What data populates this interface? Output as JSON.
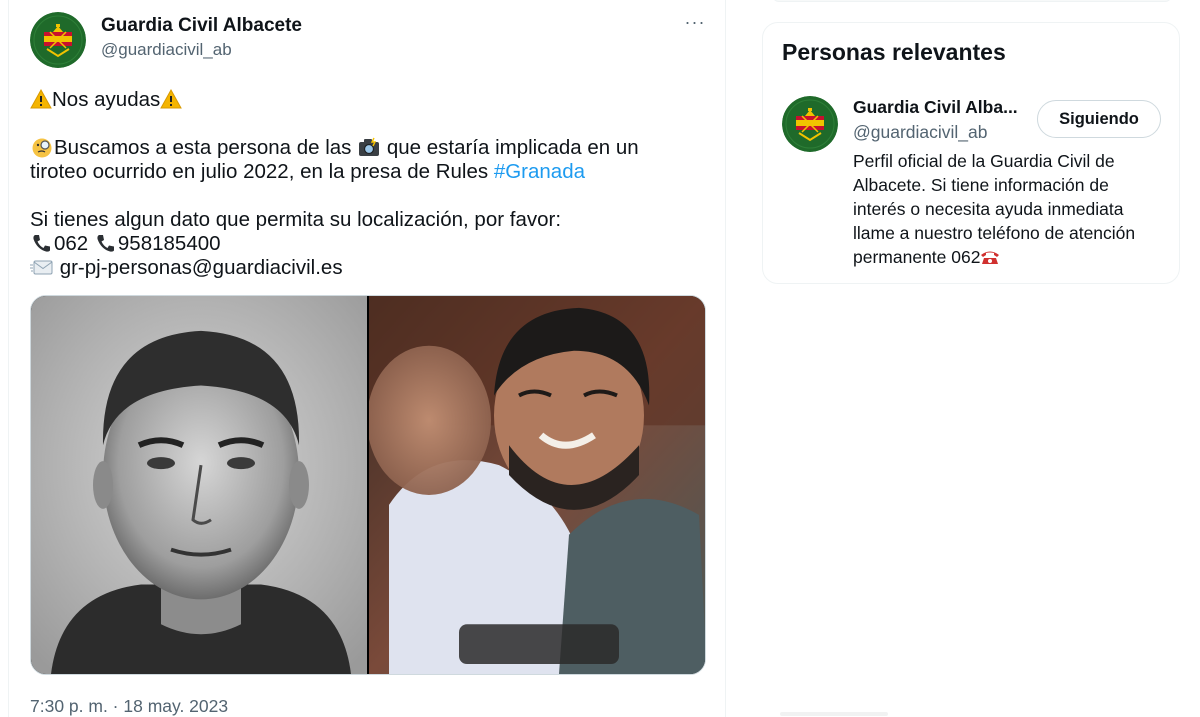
{
  "tweet": {
    "author_name": "Guardia Civil Albacete",
    "author_handle": "@guardiacivil_ab",
    "more_icon": "more-horizontal-icon",
    "text": {
      "line1": "Nos ayudas",
      "line2a": "Buscamos a esta persona de las ",
      "line2b": " que estaría implicada en un",
      "line3a": "tiroteo ocurrido en julio 2022, en la presa de Rules ",
      "hashtag": "#Granada",
      "line4": "Si tienes algun dato que permita su localización, por favor:",
      "phone1": "062 ",
      "phone2": "958185400",
      "email": " gr-pj-personas@guardiacivil.es"
    },
    "emoji_icons": [
      "warning-icon",
      "magnifier-face-icon",
      "camera-flash-icon",
      "phone-icon",
      "envelope-icon"
    ],
    "timestamp": "7:30 p. m. · 18 may. 2023"
  },
  "sidebar": {
    "card_title": "Personas relevantes",
    "person": {
      "name": "Guardia Civil Alba...",
      "handle": "@guardiacivil_ab",
      "follow_label": "Siguiendo",
      "bio": "Perfil oficial de la Guardia Civil de Albacete. Si tiene información de interés o necesita ayuda inmediata llame a nuestro teléfono de atención permanente 062",
      "bio_icon": "telephone-icon"
    }
  },
  "colors": {
    "text": "#0f1419",
    "secondary": "#536471",
    "link": "#1d9bf0",
    "border": "#eff3f4",
    "logo_green": "#1f6a2a",
    "logo_red": "#c8102e",
    "logo_yellow": "#f2c300"
  }
}
